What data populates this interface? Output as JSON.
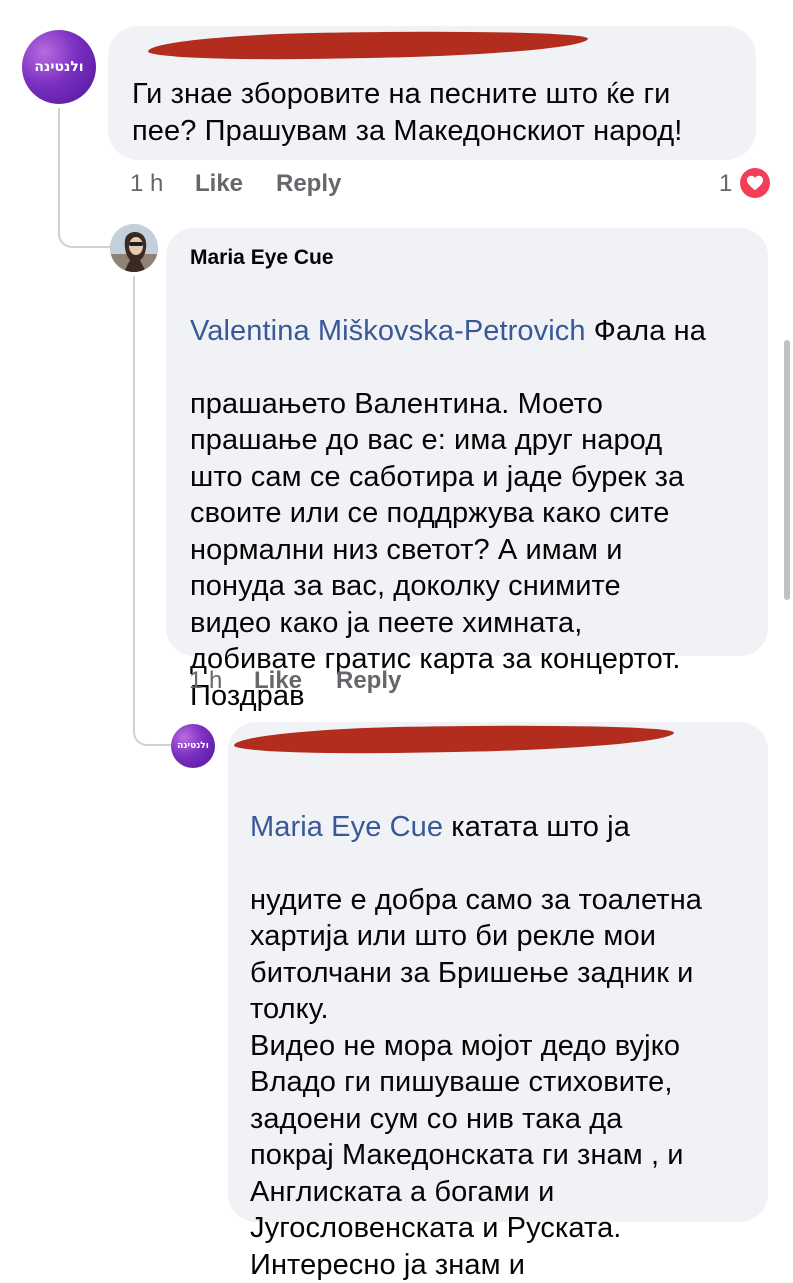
{
  "comments": [
    {
      "avatar_text": "ולנטינה",
      "text": "Ги знае зборовите на песните што ќе ги\nпее? Прашувам за Македонскиот народ!",
      "time": "1 h",
      "like_label": "Like",
      "reply_label": "Reply",
      "reaction_count": "1",
      "reaction_icon": "heart-icon",
      "reaction_color": "#f33e58"
    },
    {
      "author": "Maria Eye Cue",
      "mention": "Valentina Miškovska-Petrovich",
      "text_first_line_rest": " Фала на",
      "text": "прашањето Валентина. Моето\nпрашање до вас е: има друг народ\nшто сам се саботира и јаде бурек за\nсвоите или се поддржува како сите\nнормални низ светот? А имам и\nпонуда за вас, доколку снимите\nвидео како ја пеете химната,\nдобивате гратис карта за концертот.\nПоздрав",
      "time": "1 h",
      "like_label": "Like",
      "reply_label": "Reply"
    },
    {
      "avatar_text": "ולנטינה",
      "mention": "Maria Eye Cue",
      "text_first_line_rest": " катата што ја",
      "text": "нудите е добра само за тоалетна\nхартија или што би рекле мои\nбитолчани за Бришење задник и\nтолку.\nВидео не мора мојот дедо вујко\nВладо ги пишуваше стиховите,\nзадоени сум со нив  така да\nпокрај Македонската ги знам , и\nАнглиската а богами и\nЈугословенската и Руската.\nИнтересно ја знам и"
    }
  ],
  "colors": {
    "bubble": "#f0f2f5",
    "mention": "#385898",
    "meta_text": "#65676b",
    "redaction": "#b32d1e"
  }
}
